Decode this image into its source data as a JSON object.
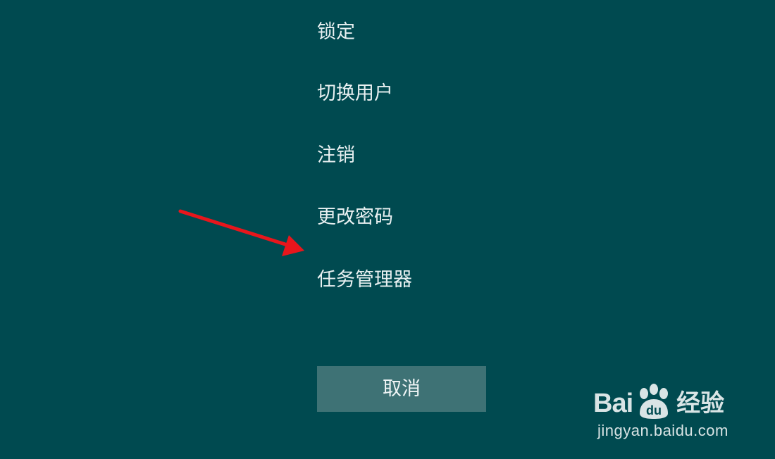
{
  "menu": {
    "items": [
      {
        "label": "锁定"
      },
      {
        "label": "切换用户"
      },
      {
        "label": "注销"
      },
      {
        "label": "更改密码"
      },
      {
        "label": "任务管理器"
      }
    ]
  },
  "cancel": {
    "label": "取消"
  },
  "annotation": {
    "arrow_icon": "red-arrow-icon",
    "color": "#e8161c"
  },
  "watermark": {
    "brand_latin_a": "Bai",
    "brand_latin_b": "du",
    "brand_cn": "经验",
    "url": "jingyan.baidu.com"
  },
  "colors": {
    "background": "#004a50",
    "button": "#3e7275",
    "text": "#e8f0f1"
  }
}
